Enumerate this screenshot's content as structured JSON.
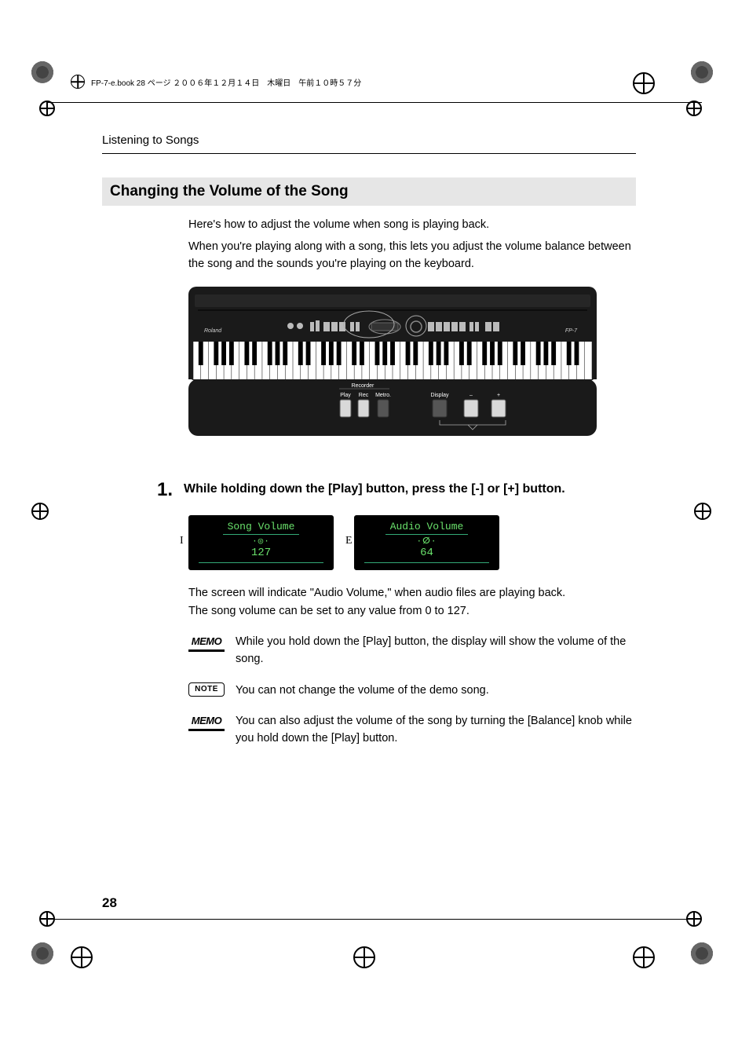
{
  "header": {
    "book_stamp": "FP-7-e.book  28 ページ  ２００６年１２月１４日　木曜日　午前１０時５７分"
  },
  "running_head": "Listening to Songs",
  "section_heading": "Changing the Volume of the Song",
  "intro": {
    "line1": "Here's how to adjust the volume when song is playing back.",
    "line2": "When you're playing along with a song, this lets you adjust the volume balance between the song and the sounds you're playing on the keyboard."
  },
  "keyboard": {
    "brand": "Roland",
    "model": "FP-7",
    "callouts": {
      "group_label": "Recorder",
      "btn_play": "Play",
      "btn_rec": "Rec",
      "btn_metro": "Metro.",
      "btn_display": "Display",
      "btn_minus": "–",
      "btn_plus": "+"
    }
  },
  "step": {
    "number": "1.",
    "text": "While holding down the [Play] button, press the [-] or [+] button."
  },
  "lcd": {
    "left": {
      "side": "I",
      "title": "Song Volume",
      "knob": "·◎·",
      "value": "127"
    },
    "right": {
      "side": "E",
      "title": "Audio Volume",
      "knob": "·ⵁ·",
      "value": "64"
    }
  },
  "after_lcd": {
    "line1": "The screen will indicate \"Audio Volume,\" when audio files are playing back.",
    "line2": "The song volume can be set to any value from 0 to 127."
  },
  "notes": [
    {
      "badge": "MEMO",
      "type": "memo",
      "text": "While you hold down the [Play] button, the display will show the volume of the song."
    },
    {
      "badge": "NOTE",
      "type": "note",
      "text": "You can not change the volume of the demo song."
    },
    {
      "badge": "MEMO",
      "type": "memo",
      "text": "You can also adjust the volume of the song by turning the [Balance] knob while you hold down the [Play] button."
    }
  ],
  "page_number": "28"
}
